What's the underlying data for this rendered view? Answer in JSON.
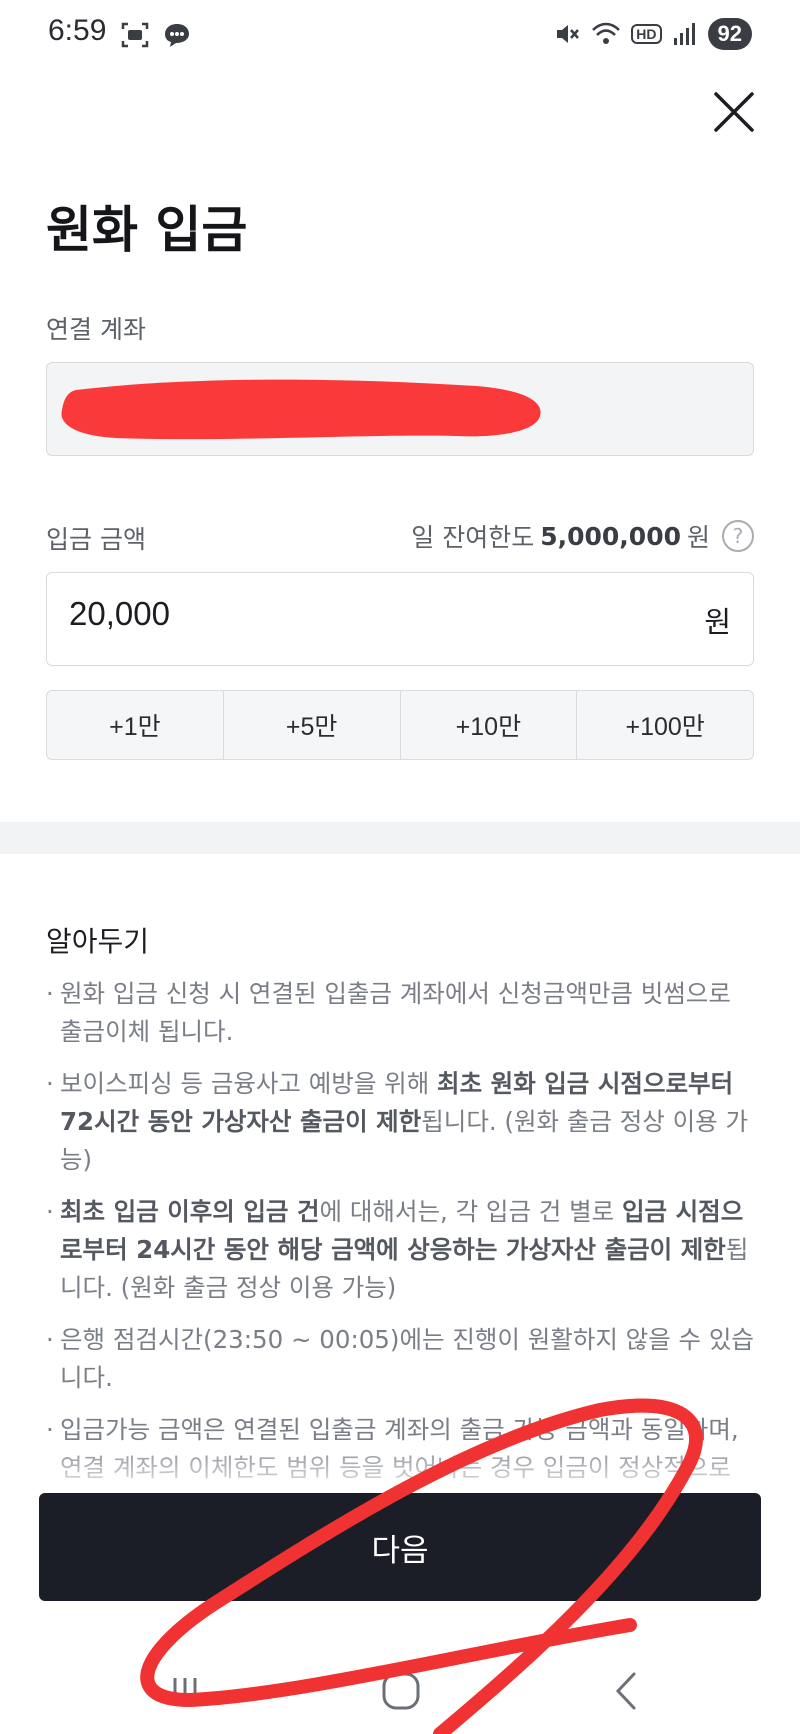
{
  "status_bar": {
    "time": "6:59",
    "battery": "92",
    "hd_label": "HD"
  },
  "page": {
    "title": "원화 입금",
    "close_icon": "close-icon"
  },
  "account": {
    "label": "연결 계좌",
    "value_redacted": true
  },
  "amount": {
    "label": "입금 금액",
    "limit_prefix": "일 잔여한도",
    "limit_value": "5,000,000",
    "limit_unit": "원",
    "help_symbol": "?",
    "value": "20,000",
    "unit": "원"
  },
  "quick_add": [
    {
      "label": "+1만"
    },
    {
      "label": "+5만"
    },
    {
      "label": "+10만"
    },
    {
      "label": "+100만"
    }
  ],
  "notice": {
    "title": "알아두기",
    "items": [
      {
        "parts": [
          {
            "text": "원화 입금 신청 시 연결된 입출금 계좌에서 신청금액만큼 빗썸으로 출금이체 됩니다.",
            "bold": false
          }
        ]
      },
      {
        "parts": [
          {
            "text": "보이스피싱 등 금융사고 예방을 위해 ",
            "bold": false
          },
          {
            "text": "최초 원화 입금 시점으로부터 72시간 동안 가상자산 출금이 제한",
            "bold": true
          },
          {
            "text": "됩니다. (원화 출금 정상 이용 가능)",
            "bold": false
          }
        ]
      },
      {
        "parts": [
          {
            "text": "최초 입금 이후의 입금 건",
            "bold": true
          },
          {
            "text": "에 대해서는, 각 입금 건 별로 ",
            "bold": false
          },
          {
            "text": "입금 시점으로부터 24시간 동안 해당 금액에 상응하는 가상자산 출금이 제한",
            "bold": true
          },
          {
            "text": "됩니다. (원화 출금 정상 이용 가능)",
            "bold": false
          }
        ]
      },
      {
        "parts": [
          {
            "text": "은행 점검시간(23:50 ~ 00:05)에는 진행이 원활하지 않을 수 있습니다.",
            "bold": false
          }
        ]
      },
      {
        "parts": [
          {
            "text": "입금가능 금액은 연결된 입출금 계좌의 출금 가능 금액과 동일하며, 연결 계좌의 이체한도 범위 등을 벗어나는 경우 입금이 정상적으로 진행되지 않을 수 있습니다.",
            "bold": false
          }
        ]
      }
    ]
  },
  "next_button": {
    "label": "다음"
  },
  "colors": {
    "primary_button": "#1b1d27",
    "annotation_red": "#f03232",
    "muted_text": "#7a7e86"
  }
}
